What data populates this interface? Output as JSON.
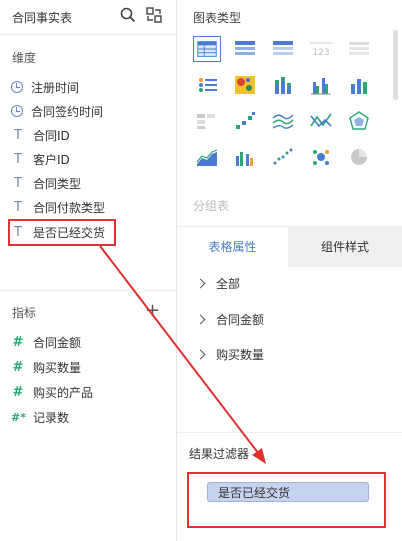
{
  "left": {
    "title": "合同事实表",
    "dimension_label": "维度",
    "dimensions": [
      {
        "icon": "clock-icon",
        "label": "注册时间"
      },
      {
        "icon": "clock-icon",
        "label": "合同签约时间"
      },
      {
        "icon": "text-type-icon",
        "label": "合同ID"
      },
      {
        "icon": "text-type-icon",
        "label": "客户ID"
      },
      {
        "icon": "text-type-icon",
        "label": "合同类型"
      },
      {
        "icon": "text-type-icon",
        "label": "合同付款类型"
      },
      {
        "icon": "text-type-icon",
        "label": "是否已经交货"
      }
    ],
    "metric_label": "指标",
    "metrics": [
      {
        "icon": "number-type-icon",
        "label": "合同金额"
      },
      {
        "icon": "number-type-icon",
        "label": "购买数量"
      },
      {
        "icon": "number-type-icon",
        "label": "购买的产品"
      },
      {
        "icon": "computed-number-icon",
        "label": "记录数"
      }
    ],
    "type_glyph_text": "T",
    "type_glyph_number": "#",
    "type_glyph_count": "#*",
    "add_glyph": "+"
  },
  "right": {
    "chart_type_title": "图表类型",
    "group_table_label": "分组表",
    "tabs": [
      "表格属性",
      "组件样式"
    ],
    "props": [
      "全部",
      "合同金额",
      "购买数量"
    ],
    "result_filter_label": "结果过滤器",
    "filter_chip": "是否已经交货"
  },
  "colors": {
    "accent": "#4a7bd0",
    "annotation_red": "#e03030",
    "chip": "#c5d3ee"
  }
}
